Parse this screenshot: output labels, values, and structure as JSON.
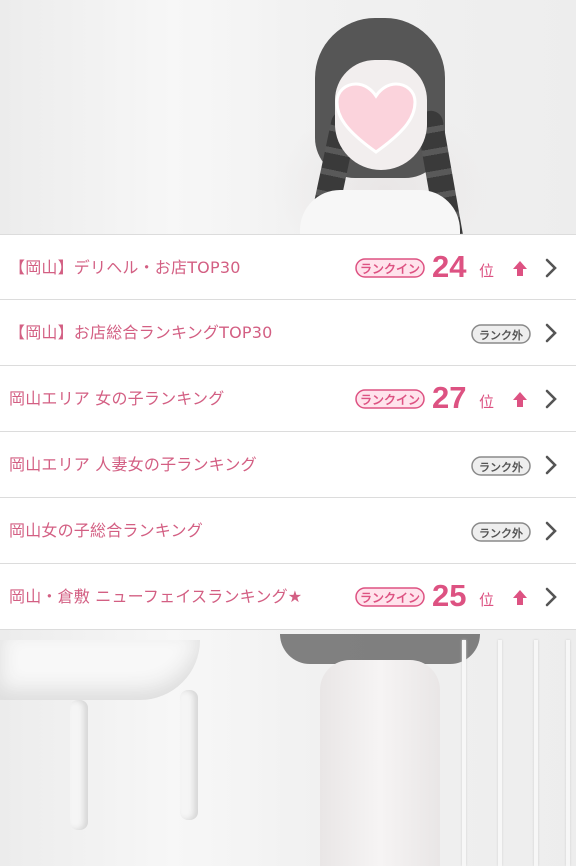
{
  "rankings": [
    {
      "title": "【岡山】デリヘル・お店TOP30",
      "status": "ランクイン",
      "rank": "24",
      "unit": "位",
      "trend": "up-arrow-icon"
    },
    {
      "title": "【岡山】お店総合ランキングTOP30",
      "status": "ランク外"
    },
    {
      "title": "岡山エリア 女の子ランキング",
      "status": "ランクイン",
      "rank": "27",
      "unit": "位",
      "trend": "up-arrow-icon"
    },
    {
      "title": "岡山エリア 人妻女の子ランキング",
      "status": "ランク外"
    },
    {
      "title": "岡山女の子総合ランキング",
      "status": "ランク外"
    },
    {
      "title": "岡山・倉敷 ニューフェイスランキング★",
      "status": "ランクイン",
      "rank": "25",
      "unit": "位",
      "trend": "up-arrow-icon"
    }
  ],
  "colors": {
    "accent": "#dd5282",
    "title_text": "#d35f83",
    "badge_out": "#8a8a8a",
    "divider": "#dcdcdc"
  }
}
